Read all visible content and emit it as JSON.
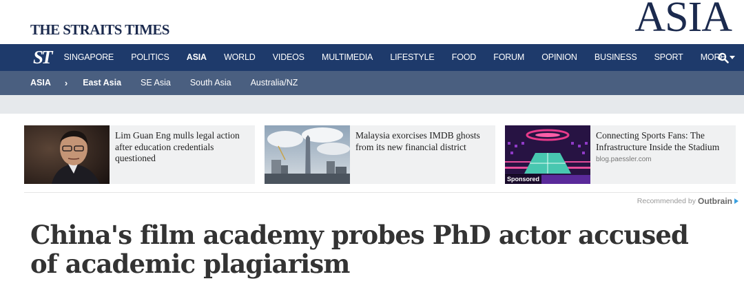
{
  "masthead": {
    "brand": "THE STRAITS TIMES",
    "section": "ASIA"
  },
  "nav": {
    "logo": "ST",
    "items": [
      {
        "label": "SINGAPORE"
      },
      {
        "label": "POLITICS"
      },
      {
        "label": "ASIA",
        "active": true
      },
      {
        "label": "WORLD"
      },
      {
        "label": "VIDEOS"
      },
      {
        "label": "MULTIMEDIA"
      },
      {
        "label": "LIFESTYLE"
      },
      {
        "label": "FOOD"
      },
      {
        "label": "FORUM"
      },
      {
        "label": "OPINION"
      },
      {
        "label": "BUSINESS"
      },
      {
        "label": "SPORT"
      },
      {
        "label": "MORE"
      }
    ],
    "search_icon": "search-icon"
  },
  "subnav": {
    "root": "ASIA",
    "separator": "›",
    "items": [
      {
        "label": "East Asia",
        "active": true
      },
      {
        "label": "SE Asia"
      },
      {
        "label": "South Asia"
      },
      {
        "label": "Australia/NZ"
      }
    ]
  },
  "recommendations": [
    {
      "title": "Lim Guan Eng mulls legal action after education credentials questioned",
      "source": "",
      "sponsored": false
    },
    {
      "title": "Malaysia exorcises IMDB ghosts from its new financial district",
      "source": "",
      "sponsored": false
    },
    {
      "title": "Connecting Sports Fans: The Infrastructure Inside the Stadium",
      "source": "blog.paessler.com",
      "sponsored": true,
      "badge": "Sponsored"
    }
  ],
  "outbrain": {
    "prefix": "Recommended by",
    "brand": "Outbrain"
  },
  "article": {
    "headline": "China's film academy probes PhD actor accused of academic plagiarism"
  },
  "colors": {
    "nav_bg": "#1e3a6b",
    "subnav_bg": "#4a5f80",
    "brand": "#1b2a4e"
  }
}
